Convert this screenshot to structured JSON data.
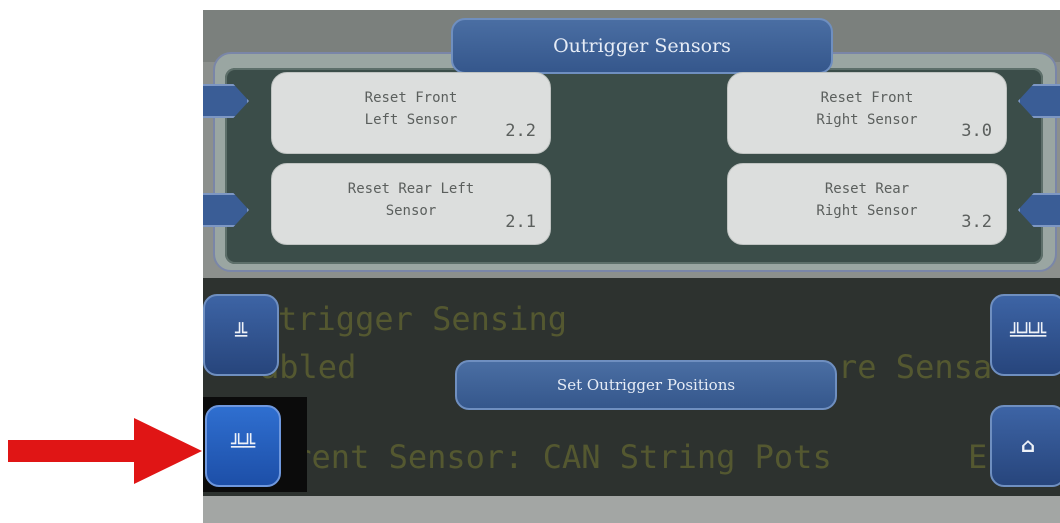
{
  "header": {
    "title": "Outrigger Sensors"
  },
  "sensors": {
    "front_left": {
      "label": "Reset Front\nLeft Sensor",
      "value": "2.2"
    },
    "rear_left": {
      "label": "Reset Rear Left\nSensor",
      "value": "2.1"
    },
    "front_right": {
      "label": "Reset Front\nRight Sensor",
      "value": "3.0"
    },
    "rear_right": {
      "label": "Reset Rear\nRight Sensor",
      "value": "3.2"
    }
  },
  "background": {
    "line1": "trigger Sensing",
    "line2a": "abled",
    "line2b": "re Sensa",
    "line3a": "rrent Sensor:  CAN String Pots",
    "line3b": "E"
  },
  "actions": {
    "set_positions_label": "Set Outrigger Positions"
  },
  "icons": {
    "left_tab": "outrigger-single-icon",
    "right_tab": "outrigger-multi-icon",
    "home": "home-icon",
    "highlighted": "outrigger-multi-icon"
  },
  "colors": {
    "accent_blue": "#35578c",
    "annotation_red": "#e01515"
  }
}
